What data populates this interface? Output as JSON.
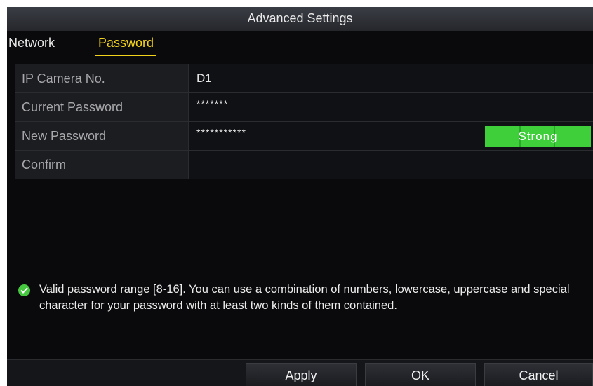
{
  "window": {
    "title": "Advanced Settings"
  },
  "tabs": [
    {
      "label": "Network",
      "active": false
    },
    {
      "label": "Password",
      "active": true
    }
  ],
  "form": {
    "rows": [
      {
        "label": "IP Camera No.",
        "value": "D1"
      },
      {
        "label": "Current Password",
        "value": "*******"
      },
      {
        "label": "New Password",
        "value": "***********"
      },
      {
        "label": "Confirm",
        "value": ""
      }
    ],
    "strength": {
      "label": "Strong",
      "color": "#3fcf3b"
    }
  },
  "hint": {
    "icon": "check-circle-icon",
    "text": "Valid password range [8-16]. You can use a combination of numbers, lowercase, uppercase and special character for your password with at least two kinds of them contained."
  },
  "buttons": {
    "apply": "Apply",
    "ok": "OK",
    "cancel": "Cancel"
  },
  "colors": {
    "accent": "#f2d21a",
    "background": "#0a0a0c",
    "success": "#46c840"
  }
}
